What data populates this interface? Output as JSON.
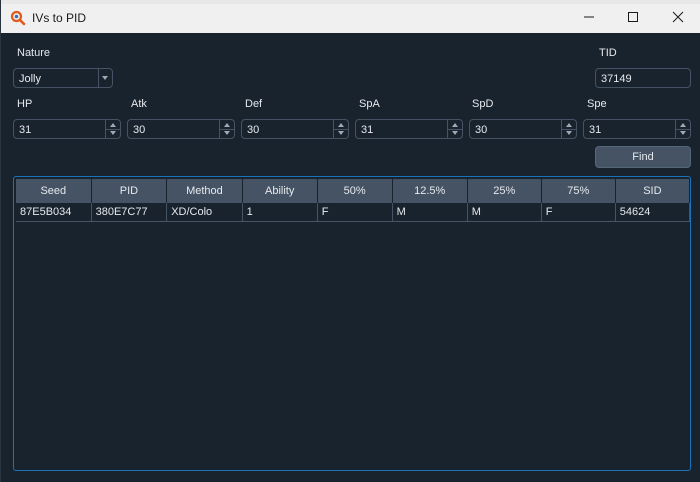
{
  "window": {
    "title": "IVs to PID",
    "buttons": [
      "minimize",
      "maximize",
      "close"
    ]
  },
  "form": {
    "nature_label": "Nature",
    "nature_value": "Jolly",
    "tid_label": "TID",
    "tid_value": "37149",
    "stats": [
      {
        "label": "HP",
        "value": "31"
      },
      {
        "label": "Atk",
        "value": "30"
      },
      {
        "label": "Def",
        "value": "30"
      },
      {
        "label": "SpA",
        "value": "31"
      },
      {
        "label": "SpD",
        "value": "30"
      },
      {
        "label": "Spe",
        "value": "31"
      }
    ],
    "find_label": "Find"
  },
  "table": {
    "headers": [
      "Seed",
      "PID",
      "Method",
      "Ability",
      "50%",
      "12.5%",
      "25%",
      "75%",
      "SID"
    ],
    "rows": [
      [
        "87E5B034",
        "380E7C77",
        "XD/Colo",
        "1",
        "F",
        "M",
        "M",
        "F",
        "54624"
      ]
    ]
  },
  "colors": {
    "background": "#19232d",
    "field_border": "#455364",
    "header_bg": "#455364",
    "table_border": "#1a72bb",
    "app_icon": "#e05a1c"
  }
}
